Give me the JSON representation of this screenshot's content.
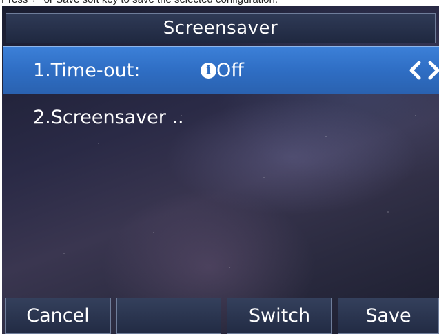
{
  "caption": "Press ← or Save soft key to save the selected configuration.",
  "screen": {
    "title": "Screensaver",
    "items": [
      {
        "label": "1.Time-out:",
        "value": "Off",
        "info_icon": "info-icon",
        "selected": true
      },
      {
        "label": "2.Screensaver ..",
        "selected": false
      }
    ],
    "softkeys": [
      "Cancel",
      "",
      "Switch",
      "Save"
    ]
  },
  "colors": {
    "selection": "#2f6ec4",
    "titlebar": "#2f3a56",
    "text": "#ffffff"
  }
}
